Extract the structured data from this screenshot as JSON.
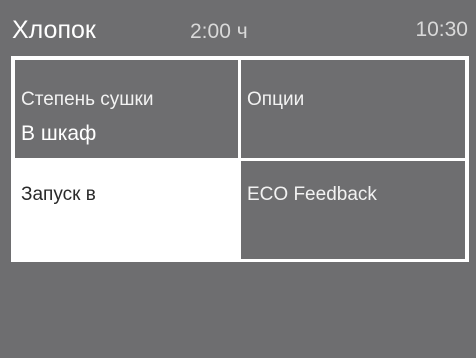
{
  "header": {
    "program_name": "Хлопок",
    "duration": "2:00 ч",
    "time": "10:30"
  },
  "tiles": {
    "drying_level": {
      "label": "Степень сушки",
      "value": "В шкаф"
    },
    "options": {
      "label": "Опции"
    },
    "delay_start": {
      "label": "Запуск в"
    },
    "eco_feedback": {
      "label": "ECO Feedback"
    }
  }
}
